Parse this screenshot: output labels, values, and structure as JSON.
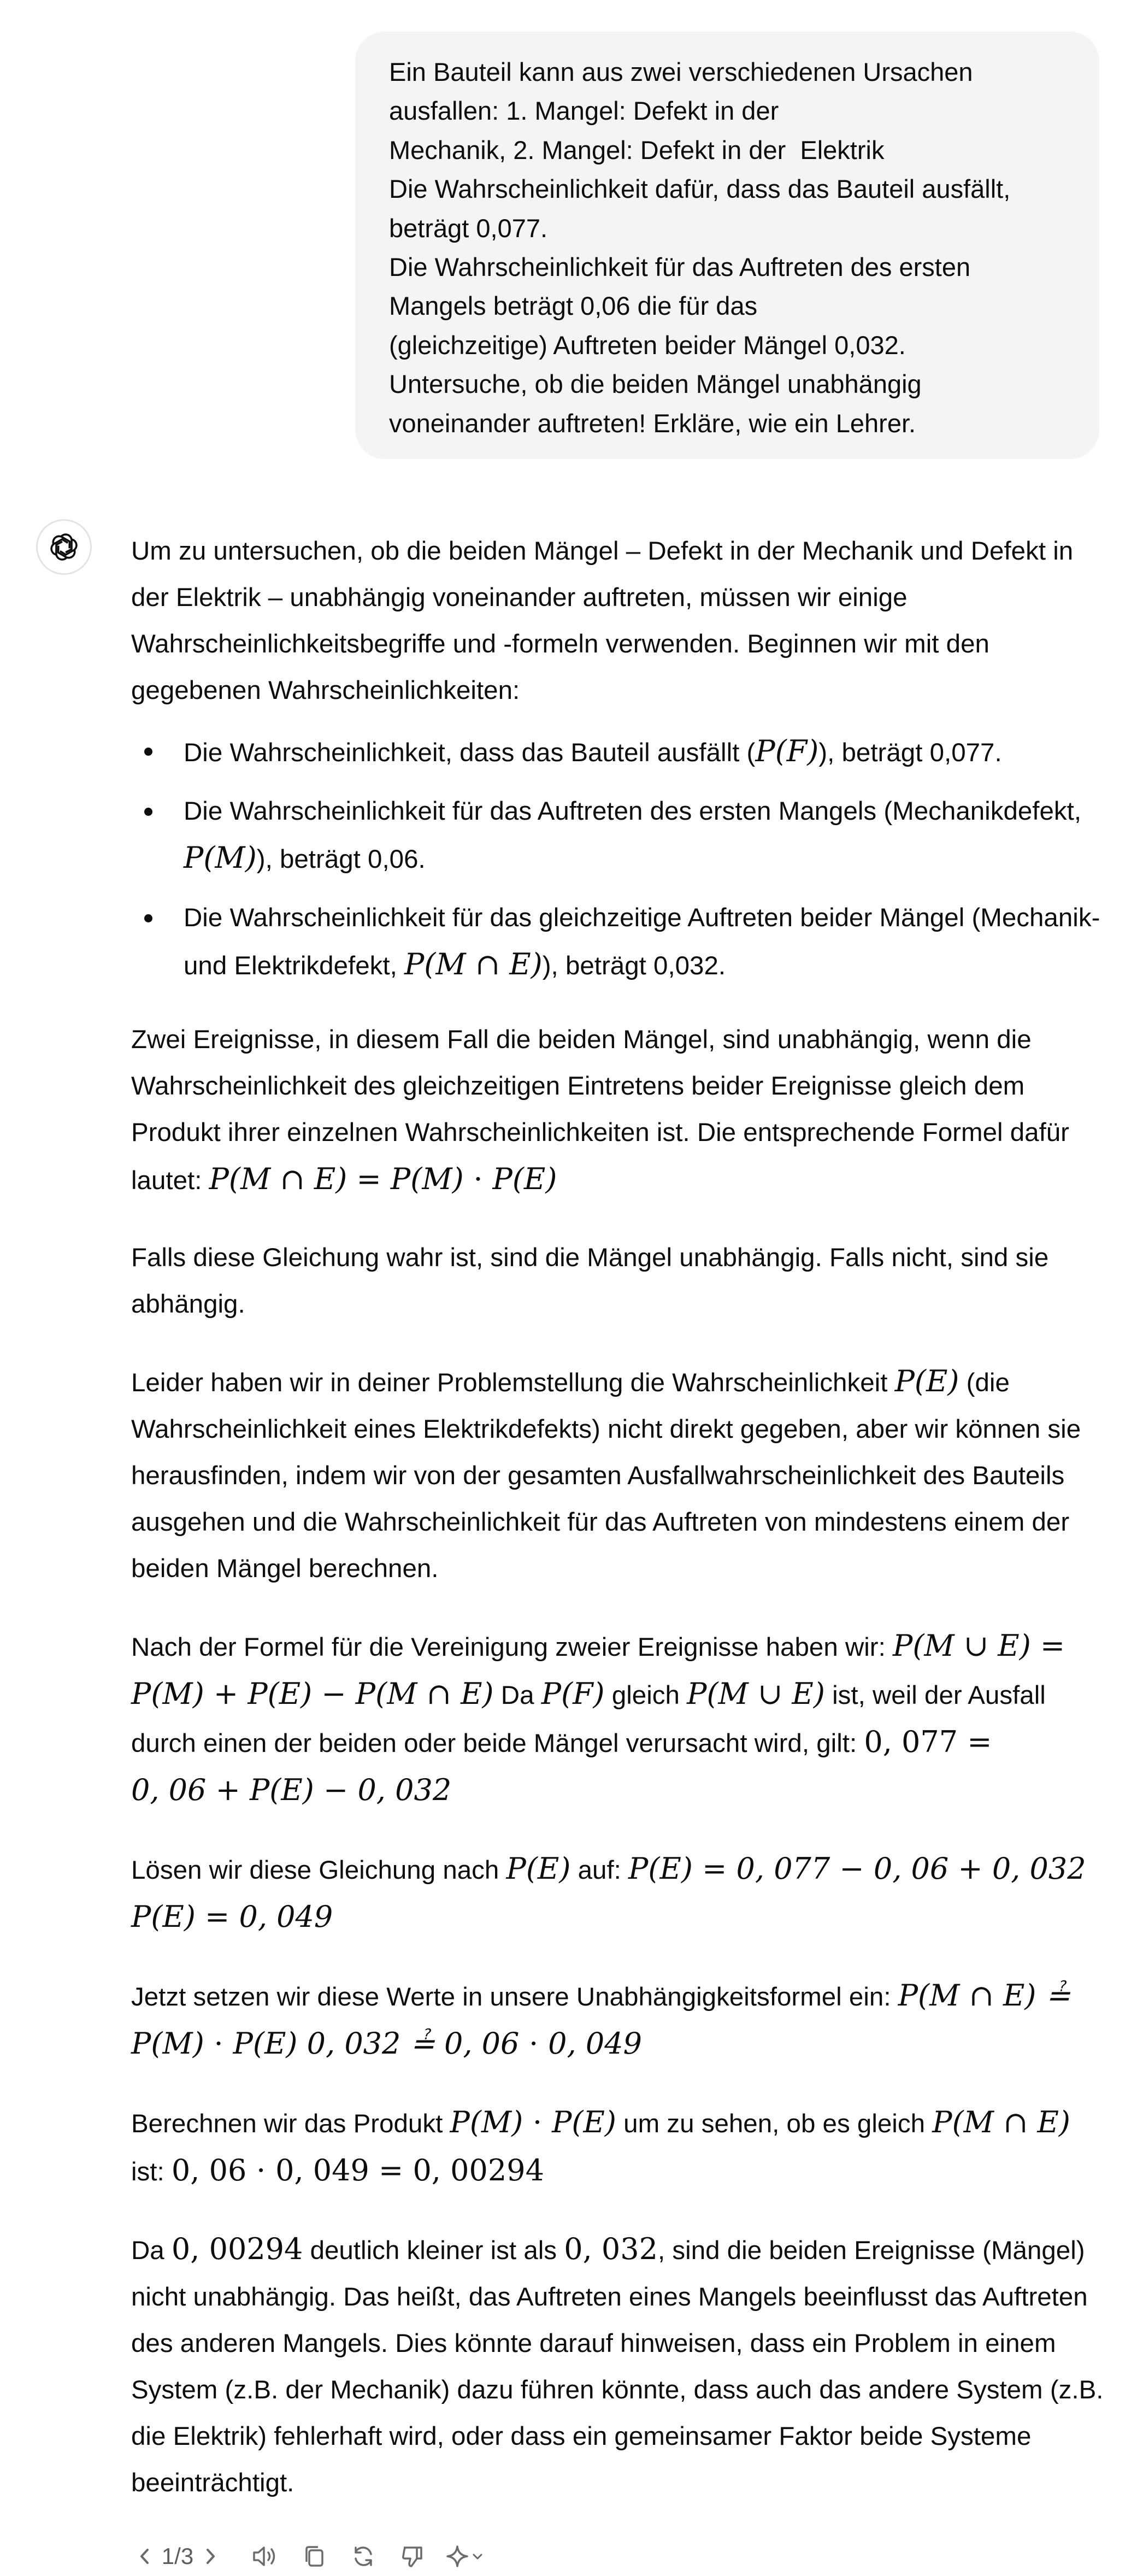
{
  "user_message": {
    "lines": [
      "Ein Bauteil kann aus zwei verschiedenen Ursachen",
      "ausfallen: 1. Mangel: Defekt in der",
      "Mechanik, 2. Mangel: Defekt in der  Elektrik",
      "Die Wahrscheinlichkeit dafür, dass das Bauteil ausfällt,",
      "beträgt 0,077.",
      "Die Wahrscheinlichkeit für das Auftreten des ersten",
      "Mangels beträgt 0,06 die für das",
      "(gleichzeitige) Auftreten beider Mängel 0,032.",
      "Untersuche, ob die beiden Mängel unabhängig",
      "voneinander auftreten! Erkläre, wie ein Lehrer."
    ]
  },
  "assistant": {
    "avatar_icon": "openai-logo-icon",
    "intro": "Um zu untersuchen, ob die beiden Mängel – Defekt in der Mechanik und Defekt in der Elektrik – unabhängig voneinander auftreten, müssen wir einige Wahrscheinlichkeitsbegriffe und -formeln verwenden. Beginnen wir mit den gegebenen Wahrscheinlichkeiten:",
    "bullets": [
      {
        "pre": "Die Wahrscheinlichkeit, dass das Bauteil ausfällt (",
        "math": "P(F)",
        "post": "), beträgt 0,077."
      },
      {
        "pre": "Die Wahrscheinlichkeit für das Auftreten des ersten Mangels (Mechanikdefekt, ",
        "math": "P(M)",
        "post": "), beträgt 0,06."
      },
      {
        "pre": "Die Wahrscheinlichkeit für das gleichzeitige Auftreten beider Mängel (Mechanik- und Elektrikdefekt, ",
        "math": "P(M ∩ E)",
        "post": "), beträgt 0,032."
      }
    ],
    "p_independence": "Zwei Ereignisse, in diesem Fall die beiden Mängel, sind unabhängig, wenn die Wahrscheinlichkeit des gleichzeitigen Eintretens beider Ereignisse gleich dem Produkt ihrer einzelnen Wahrscheinlichkeiten ist. Die entsprechende Formel dafür lautet: ",
    "f_independence": "P(M ∩ E) = P(M) ⋅ P(E)",
    "p_if_true": "Falls diese Gleichung wahr ist, sind die Mängel unabhängig. Falls nicht, sind sie abhängig.",
    "p_missing_a": "Leider haben wir in deiner Problemstellung die Wahrscheinlichkeit ",
    "p_missing_math": "P(E)",
    "p_missing_b": " (die Wahrscheinlichkeit eines Elektrikdefekts) nicht direkt gegeben, aber wir können sie herausfinden, indem wir von der gesamten Ausfallwahrscheinlichkeit des Bauteils ausgehen und die Wahrscheinlichkeit für das Auftreten von mindestens einem der beiden Mängel berechnen.",
    "p_union_a": "Nach der Formel für die Vereinigung zweier Ereignisse haben wir: ",
    "p_union_f1": "P(M ∪ E) =",
    "p_union_f2": "P(M) + P(E) − P(M ∩ E)",
    "p_union_b": " Da ",
    "p_union_pf": "P(F)",
    "p_union_c": " gleich ",
    "p_union_pmue": "P(M ∪ E)",
    "p_union_d": " ist, weil der Ausfall durch einen der beiden oder beide Mängel verursacht wird, gilt: ",
    "p_union_f3": "0, 077 =",
    "p_union_f4": "0, 06 + P(E) − 0, 032",
    "p_solve_a": "Lösen wir diese Gleichung nach ",
    "p_solve_pe": "P(E)",
    "p_solve_b": " auf: ",
    "p_solve_f1": "P(E) = 0, 077 − 0, 06 + 0, 032",
    "p_solve_f2": "P(E) = 0, 049",
    "p_insert_a": "Jetzt setzen wir diese Werte in unsere Unabhängigkeitsformel ein: ",
    "p_insert_f1": "P(M ∩ E) ≟",
    "p_insert_f2": "P(M) ⋅ P(E) 0, 032 ≟ 0, 06 ⋅ 0, 049",
    "p_product_a": "Berechnen wir das Produkt ",
    "p_product_f1": "P(M) ⋅ P(E)",
    "p_product_b": " um zu sehen, ob es gleich ",
    "p_product_f2": "P(M ∩ E)",
    "p_product_c": "ist: ",
    "p_product_f3": "0, 06 ⋅ 0, 049 = 0, 00294",
    "p_concl_a": "Da ",
    "p_concl_f1": "0, 00294",
    "p_concl_b": " deutlich kleiner ist als ",
    "p_concl_f2": "0, 032",
    "p_concl_c": ", sind die beiden Ereignisse (Mängel) nicht unabhängig. Das heißt, das Auftreten eines Mangels beeinflusst das Auftreten des anderen Mangels. Dies könnte darauf hinweisen, dass ein Problem in einem System (z.B. der Mechanik) dazu führen könnte, dass auch das andere System (z.B. die Elektrik) fehlerhaft wird, oder dass ein gemeinsamer Faktor beide Systeme beeinträchtigt."
  },
  "toolbar": {
    "page_indicator": "1/3",
    "icons": [
      "chevron-left-icon",
      "chevron-right-icon",
      "speaker-icon",
      "copy-icon",
      "regenerate-icon",
      "thumbs-down-icon",
      "sparkle-icon",
      "chevron-down-icon"
    ]
  }
}
